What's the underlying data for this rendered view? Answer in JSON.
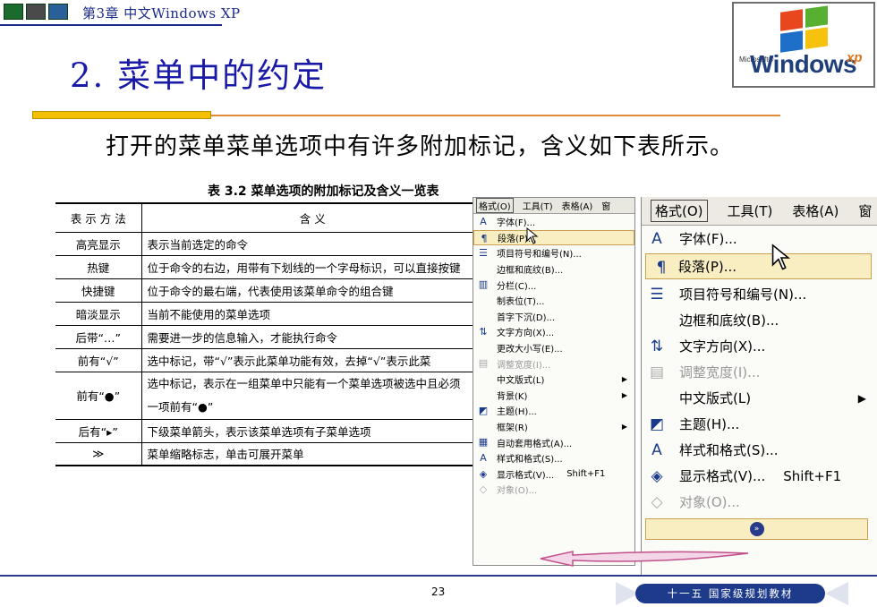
{
  "header": {
    "chapter": "第3章  中文Windows XP"
  },
  "logo": {
    "ms": "Microsoft®",
    "word": "Windows",
    "xp": "xp"
  },
  "slide": {
    "title": "2. 菜单中的约定",
    "subtitle": "打开的菜单菜单选项中有许多附加标记，含义如下表所示。"
  },
  "table": {
    "caption": "表 3.2  菜单选项的附加标记及含义一览表",
    "headers": [
      "表 示 方 法",
      "含    义"
    ],
    "rows": [
      [
        "高亮显示",
        "表示当前选定的命令"
      ],
      [
        "热键",
        "位于命令的右边，用带有下划线的一个字母标识，可以直接按键"
      ],
      [
        "快捷键",
        "位于命令的最右端，代表使用该菜单命令的组合键"
      ],
      [
        "暗淡显示",
        "当前不能使用的菜单选项"
      ],
      [
        "后带“…”",
        "需要进一步的信息输入，才能执行命令"
      ],
      [
        "前有“√”",
        "选中标记，带“√”表示此菜单功能有效，去掉“√”表示此菜"
      ],
      [
        "前有“●”",
        "选中标记，表示在一组菜单中只能有一个菜单选项被选中且必须"
      ],
      [
        "后有“▸”",
        "下级菜单箭头，表示该菜单选项有子菜单选项"
      ],
      [
        "≫",
        "菜单缩略标志，单击可展开菜单"
      ]
    ],
    "row7_line2": "一项前有“●”"
  },
  "menu_full": {
    "bar": [
      "格式(O)",
      "工具(T)",
      "表格(A)",
      "窗"
    ],
    "items": [
      {
        "icon": "A",
        "label": "字体(F)..."
      },
      {
        "icon": "¶",
        "label": "段落(P)..."
      },
      {
        "icon": "☰",
        "label": "项目符号和编号(N)..."
      },
      {
        "icon": "",
        "label": "边框和底纹(B)..."
      },
      {
        "icon": "▥",
        "label": "分栏(C)..."
      },
      {
        "icon": "",
        "label": "制表位(T)..."
      },
      {
        "icon": "",
        "label": "首字下沉(D)..."
      },
      {
        "icon": "⇅",
        "label": "文字方向(X)..."
      },
      {
        "icon": "",
        "label": "更改大小写(E)..."
      },
      {
        "icon": "▤",
        "label": "调整宽度(I)..."
      },
      {
        "icon": "",
        "label": "中文版式(L)"
      },
      {
        "icon": "",
        "label": "背景(K)"
      },
      {
        "icon": "◩",
        "label": "主题(H)..."
      },
      {
        "icon": "",
        "label": "框架(R)"
      },
      {
        "icon": "▦",
        "label": "自动套用格式(A)..."
      },
      {
        "icon": "A",
        "label": "样式和格式(S)..."
      },
      {
        "icon": "◈",
        "label": "显示格式(V)...",
        "shortcut": "Shift+F1"
      },
      {
        "icon": "◇",
        "label": "对象(O)..."
      }
    ]
  },
  "menu_short": {
    "bar": [
      "格式(O)",
      "工具(T)",
      "表格(A)",
      "窗"
    ],
    "items": [
      {
        "icon": "A",
        "label": "字体(F)..."
      },
      {
        "icon": "¶",
        "label": "段落(P)..."
      },
      {
        "icon": "☰",
        "label": "项目符号和编号(N)..."
      },
      {
        "icon": "",
        "label": "边框和底纹(B)..."
      },
      {
        "icon": "⇅",
        "label": "文字方向(X)..."
      },
      {
        "icon": "▤",
        "label": "调整宽度(I)..."
      },
      {
        "icon": "",
        "label": "中文版式(L)"
      },
      {
        "icon": "◩",
        "label": "主题(H)..."
      },
      {
        "icon": "A",
        "label": "样式和格式(S)..."
      },
      {
        "icon": "◈",
        "label": "显示格式(V)...",
        "shortcut": "Shift+F1"
      },
      {
        "icon": "◇",
        "label": "对象(O)..."
      }
    ],
    "expand_glyph": "»"
  },
  "footer": {
    "page": "23",
    "badge": "十一五 国家级规划教材"
  },
  "colors": {
    "title": "#1a1aa8",
    "accent": "#f2c000",
    "line": "#e08a3a",
    "navy": "#1e3a8a"
  }
}
